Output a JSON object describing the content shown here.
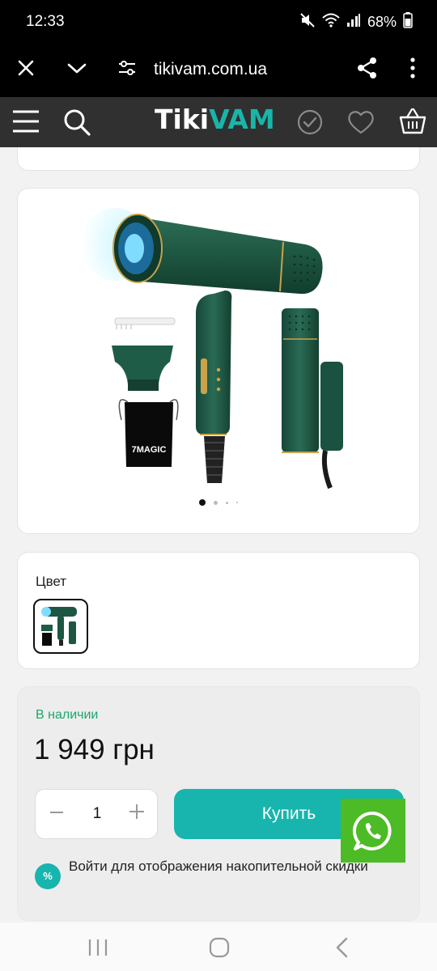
{
  "status_bar": {
    "time": "12:33",
    "battery": "68%"
  },
  "browser": {
    "url": "tikivam.com.ua"
  },
  "site": {
    "logo_part1": "Tiki",
    "logo_part2": "VAM"
  },
  "product": {
    "image_brand": "7MAGIC",
    "carousel_total": 4,
    "carousel_active": 1
  },
  "color_section": {
    "label": "Цвет"
  },
  "buy_section": {
    "stock": "В наличии",
    "price": "1 949 грн",
    "quantity": "1",
    "buy_label": "Купить",
    "promo_badge": "%",
    "promo_text": "Войти для отображения накопительной скидки"
  },
  "colors": {
    "accent": "#17b5ad",
    "stock": "#1aa86b",
    "whatsapp": "#4cbb26",
    "header": "#303030"
  },
  "icons": [
    "close-icon",
    "chevron-down-icon",
    "site-settings-icon",
    "share-icon",
    "more-icon",
    "menu-icon",
    "search-icon",
    "compare-icon",
    "heart-icon",
    "cart-icon",
    "whatsapp-icon"
  ]
}
